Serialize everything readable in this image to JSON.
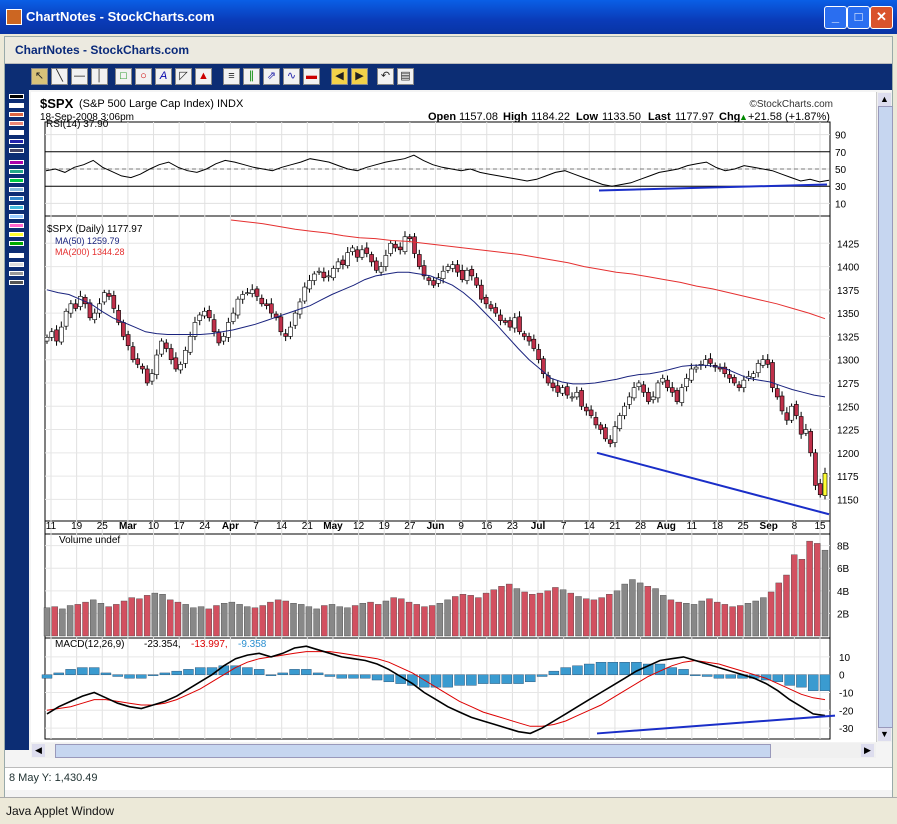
{
  "window": {
    "title": "ChartNotes - StockCharts.com",
    "subtitle": "ChartNotes - StockCharts.com",
    "footer": "Java Applet Window"
  },
  "chart_header": {
    "symbol": "$SPX",
    "name": "(S&P 500 Large Cap Index) INDX",
    "date": "18-Sep-2008 3:06pm",
    "watermark": "©StockCharts.com",
    "open_label": "Open",
    "open": "1157.08",
    "high_label": "High",
    "high": "1184.22",
    "low_label": "Low",
    "low": "1133.50",
    "last_label": "Last",
    "last": "1177.97",
    "chg_label": "Chg",
    "chg": "+21.58 (+1.87%)",
    "chg_arrow": "▲"
  },
  "rsi": {
    "label": "RSI(14) 37.90",
    "ticks": [
      "90",
      "70",
      "50",
      "30",
      "10"
    ]
  },
  "price_legend": {
    "main": "$SPX (Daily) 1177.97",
    "ma50": "MA(50) 1259.79",
    "ma200": "MA(200) 1344.28"
  },
  "volume": {
    "label": "Volume undef",
    "ticks": [
      "8B",
      "6B",
      "4B",
      "2B"
    ]
  },
  "macd": {
    "label": "MACD(12,26,9)",
    "v1": "-23.354,",
    "v2": "-13.997,",
    "v3": "-9.358",
    "ticks": [
      "10",
      "0",
      "-10",
      "-20",
      "-30"
    ]
  },
  "status_text": "8 May  Y: 1,430.49",
  "colors": {
    "up": "#ffffff",
    "down": "#c0304a",
    "ma50": "#1a237e",
    "ma200": "#e53030",
    "trend": "#1a2ec8",
    "vol_up": "#888888",
    "vol_down": "#d25060",
    "hist": "#3a9bd0",
    "rsi_hl": "#ffff33"
  },
  "chart_data": {
    "type": "line",
    "x_labels": [
      "11",
      "19",
      "25",
      "Mar",
      "10",
      "17",
      "24",
      "Apr",
      "7",
      "14",
      "21",
      "May",
      "12",
      "19",
      "27",
      "Jun",
      "9",
      "16",
      "23",
      "Jul",
      "7",
      "14",
      "21",
      "28",
      "Aug",
      "11",
      "18",
      "25",
      "Sep",
      "8",
      "15"
    ],
    "y_ticks": [
      "1425",
      "1400",
      "1375",
      "1350",
      "1325",
      "1300",
      "1275",
      "1250",
      "1225",
      "1200",
      "1175",
      "1150"
    ],
    "price_ylim": [
      1130,
      1450
    ],
    "price_close": [
      1324,
      1330,
      1320,
      1335,
      1352,
      1360,
      1355,
      1368,
      1360,
      1345,
      1350,
      1360,
      1372,
      1368,
      1355,
      1340,
      1325,
      1315,
      1300,
      1295,
      1290,
      1275,
      1285,
      1305,
      1320,
      1312,
      1300,
      1290,
      1295,
      1310,
      1325,
      1340,
      1348,
      1352,
      1345,
      1330,
      1318,
      1325,
      1340,
      1350,
      1365,
      1370,
      1372,
      1375,
      1368,
      1360,
      1358,
      1350,
      1345,
      1330,
      1325,
      1335,
      1350,
      1362,
      1378,
      1385,
      1392,
      1395,
      1388,
      1390,
      1398,
      1405,
      1402,
      1415,
      1420,
      1410,
      1418,
      1414,
      1405,
      1396,
      1400,
      1412,
      1425,
      1420,
      1418,
      1432,
      1430,
      1414,
      1400,
      1390,
      1385,
      1380,
      1388,
      1395,
      1400,
      1402,
      1394,
      1386,
      1396,
      1390,
      1380,
      1365,
      1360,
      1355,
      1350,
      1342,
      1340,
      1335,
      1345,
      1330,
      1325,
      1320,
      1312,
      1300,
      1285,
      1275,
      1270,
      1265,
      1270,
      1262,
      1260,
      1265,
      1250,
      1245,
      1240,
      1230,
      1225,
      1215,
      1210,
      1228,
      1240,
      1250,
      1260,
      1270,
      1275,
      1265,
      1255,
      1260,
      1275,
      1280,
      1270,
      1265,
      1255,
      1270,
      1280,
      1290,
      1292,
      1295,
      1300,
      1296,
      1292,
      1290,
      1285,
      1280,
      1275,
      1270,
      1278,
      1282,
      1285,
      1296,
      1300,
      1295,
      1270,
      1260,
      1245,
      1235,
      1250,
      1240,
      1220,
      1225,
      1200,
      1165,
      1155,
      1178
    ],
    "ma50": [
      1375,
      1372,
      1370,
      1365,
      1360,
      1352,
      1345,
      1340,
      1335,
      1330,
      1328,
      1327,
      1327,
      1327,
      1327,
      1328,
      1330,
      1332,
      1335,
      1338,
      1342,
      1346,
      1350,
      1354,
      1358,
      1364,
      1370,
      1375,
      1380,
      1386,
      1390,
      1392,
      1394,
      1394,
      1392,
      1390,
      1385,
      1380,
      1372,
      1362,
      1350,
      1338,
      1325,
      1312,
      1300,
      1290,
      1280,
      1276,
      1274,
      1274,
      1275,
      1277,
      1279,
      1282,
      1284,
      1285,
      1287,
      1290,
      1293,
      1294,
      1294,
      1293,
      1290,
      1285,
      1280,
      1278,
      1276,
      1272,
      1268,
      1265,
      1262,
      1260
    ],
    "ma200": [
      1450,
      1448,
      1446,
      1443,
      1440,
      1438,
      1436,
      1433,
      1431,
      1430,
      1428,
      1427,
      1425,
      1423,
      1421,
      1419,
      1417,
      1415,
      1413,
      1410,
      1407,
      1404,
      1400,
      1397,
      1394,
      1392,
      1389,
      1386,
      1383,
      1379,
      1376,
      1372,
      1368,
      1364,
      1360,
      1355,
      1350,
      1344
    ],
    "rsi_values": [
      48,
      50,
      46,
      52,
      55,
      60,
      52,
      47,
      42,
      40,
      44,
      50,
      55,
      58,
      52,
      48,
      46,
      50,
      56,
      60,
      58,
      55,
      52,
      50,
      48,
      52,
      55,
      58,
      62,
      60,
      58,
      54,
      50,
      48,
      52,
      55,
      58,
      60,
      62,
      66,
      60,
      55,
      52,
      50,
      48,
      50,
      46,
      44,
      42,
      40,
      38,
      36,
      38,
      42,
      46,
      48,
      44,
      40,
      36,
      32,
      30,
      32,
      34,
      38,
      42,
      46,
      48,
      50,
      54,
      56,
      58,
      52,
      48,
      50,
      54,
      52,
      50,
      48,
      44,
      40,
      36,
      38,
      35,
      37
    ],
    "volume_b": [
      2.5,
      2.6,
      2.4,
      2.7,
      2.8,
      3.0,
      3.2,
      2.9,
      2.6,
      2.8,
      3.1,
      3.4,
      3.3,
      3.6,
      3.8,
      3.7,
      3.2,
      3.0,
      2.8,
      2.5,
      2.6,
      2.4,
      2.7,
      2.9,
      3.0,
      2.8,
      2.6,
      2.5,
      2.7,
      3.0,
      3.2,
      3.1,
      2.9,
      2.8,
      2.6,
      2.4,
      2.7,
      2.8,
      2.6,
      2.5,
      2.7,
      2.9,
      3.0,
      2.8,
      3.1,
      3.4,
      3.3,
      3.0,
      2.8,
      2.6,
      2.7,
      2.9,
      3.2,
      3.5,
      3.7,
      3.6,
      3.4,
      3.8,
      4.1,
      4.4,
      4.6,
      4.2,
      3.9,
      3.7,
      3.8,
      4.0,
      4.3,
      4.1,
      3.8,
      3.5,
      3.3,
      3.2,
      3.4,
      3.7,
      4.0,
      4.6,
      5.0,
      4.7,
      4.4,
      4.2,
      3.6,
      3.2,
      3.0,
      2.9,
      2.8,
      3.1,
      3.3,
      3.0,
      2.8,
      2.6,
      2.7,
      2.9,
      3.1,
      3.4,
      3.9,
      4.7,
      5.4,
      7.2,
      6.8,
      8.4,
      8.2,
      7.6
    ],
    "macd_line": [
      -22,
      -18,
      -15,
      -12,
      -10,
      -13,
      -16,
      -18,
      -19,
      -17,
      -15,
      -12,
      -8,
      -4,
      0,
      5,
      9,
      11,
      12,
      10,
      12,
      15,
      16,
      14,
      12,
      10,
      9,
      8,
      6,
      3,
      -1,
      -5,
      -10,
      -14,
      -18,
      -21,
      -24,
      -26,
      -28,
      -30,
      -32,
      -33,
      -30,
      -26,
      -22,
      -18,
      -14,
      -10,
      -6,
      -2,
      2,
      5,
      8,
      9,
      10,
      8,
      6,
      4,
      2,
      0,
      -2,
      -5,
      -9,
      -14,
      -18,
      -22,
      -23
    ],
    "macd_signal": [
      -20,
      -19,
      -18,
      -16,
      -14,
      -14,
      -15,
      -16,
      -17,
      -17,
      -16,
      -14,
      -11,
      -8,
      -4,
      0,
      4,
      7,
      9,
      10,
      11,
      12,
      13,
      13,
      13,
      12,
      11,
      10,
      9,
      7,
      4,
      1,
      -3,
      -7,
      -11,
      -15,
      -18,
      -21,
      -23,
      -25,
      -27,
      -29,
      -29,
      -28,
      -26,
      -23,
      -20,
      -17,
      -13,
      -9,
      -5,
      -1,
      2,
      5,
      7,
      8,
      7,
      6,
      4,
      2,
      0,
      -2,
      -5,
      -8,
      -11,
      -13,
      -14
    ],
    "macd_hist": [
      -2,
      1,
      3,
      4,
      4,
      1,
      -1,
      -2,
      -2,
      0,
      1,
      2,
      3,
      4,
      4,
      5,
      5,
      4,
      3,
      0,
      1,
      3,
      3,
      1,
      -1,
      -2,
      -2,
      -2,
      -3,
      -4,
      -5,
      -6,
      -7,
      -7,
      -7,
      -6,
      -6,
      -5,
      -5,
      -5,
      -5,
      -4,
      -1,
      2,
      4,
      5,
      6,
      7,
      7,
      7,
      7,
      6,
      6,
      4,
      3,
      0,
      -1,
      -2,
      -2,
      -2,
      -2,
      -3,
      -4,
      -6,
      -7,
      -9,
      -9
    ],
    "macd_ylim": [
      -35,
      15
    ]
  }
}
